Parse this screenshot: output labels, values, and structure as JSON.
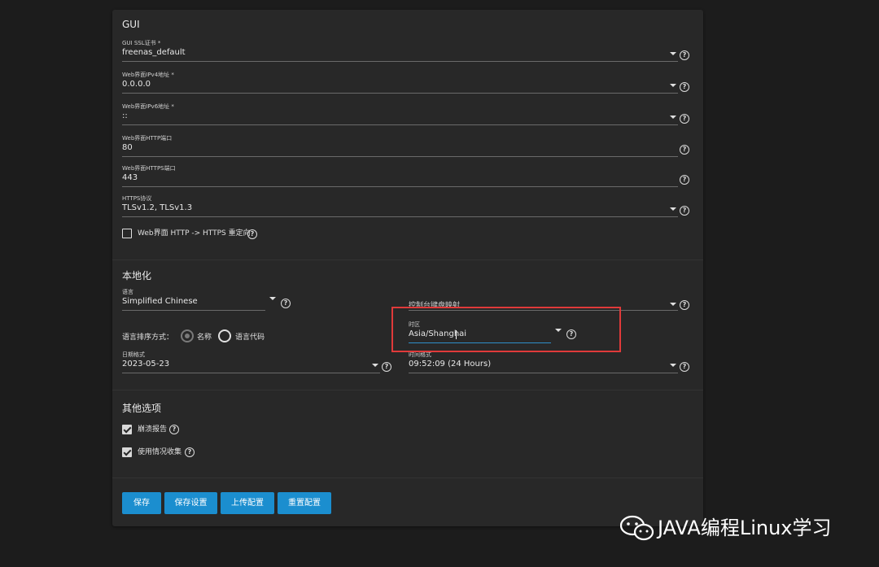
{
  "gui": {
    "title": "GUI",
    "ssl_cert": {
      "label": "GUI SSL证书 *",
      "value": "freenas_default"
    },
    "ipv4": {
      "label": "Web界面IPv4地址 *",
      "value": "0.0.0.0"
    },
    "ipv6": {
      "label": "Web界面IPv6地址 *",
      "value": "::"
    },
    "http_port": {
      "label": "Web界面HTTP端口",
      "value": "80"
    },
    "https_port": {
      "label": "Web界面HTTPS端口",
      "value": "443"
    },
    "https_protocol": {
      "label": "HTTPS协议",
      "value": "TLSv1.2, TLSv1.3"
    },
    "redirect": {
      "label": "Web界面 HTTP -> HTTPS 重定向",
      "checked": false
    }
  },
  "localization": {
    "title": "本地化",
    "language": {
      "label": "语言",
      "value": "Simplified Chinese"
    },
    "console_keymap": {
      "label": "控制台键盘映射",
      "value": ""
    },
    "sort_order": {
      "label": "语言排序方式：",
      "options": [
        {
          "label": "名称",
          "selected": true
        },
        {
          "label": "语言代码",
          "selected": false
        }
      ]
    },
    "timezone": {
      "label": "时区",
      "value": "Asia/Shanghai"
    },
    "date_format": {
      "label": "日期格式",
      "value": "2023-05-23"
    },
    "time_format": {
      "label": "时间格式",
      "value": "09:52:09 (24 Hours)"
    }
  },
  "other": {
    "title": "其他选项",
    "crash_report": {
      "label": "崩溃报告",
      "checked": true
    },
    "usage_collection": {
      "label": "使用情况收集",
      "checked": true
    }
  },
  "buttons": {
    "save": "保存",
    "save_config": "保存设置",
    "upload_config": "上传配置",
    "reset_config": "重置配置"
  },
  "watermark": {
    "text": "JAVA编程Linux学习"
  },
  "colors": {
    "accent": "#1b8ecf",
    "highlight": "#e03a3a",
    "panel": "#282828",
    "background": "#1c1c1c"
  }
}
